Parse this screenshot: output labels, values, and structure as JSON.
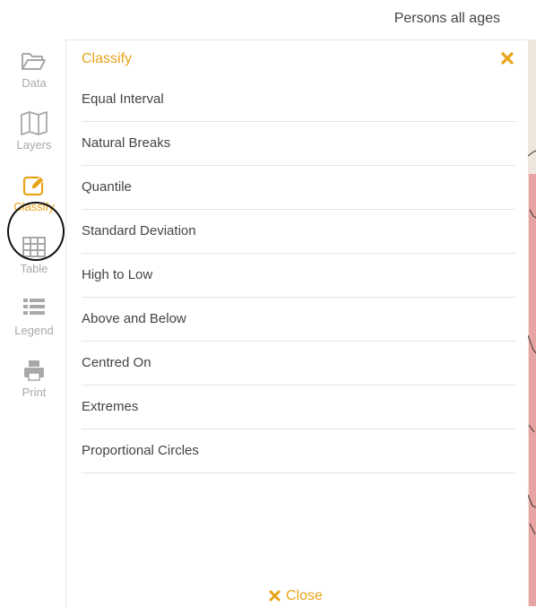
{
  "header": {
    "title": "Persons all ages"
  },
  "sidebar": {
    "items": [
      {
        "label": "Data",
        "icon": "folder-icon"
      },
      {
        "label": "Layers",
        "icon": "map-icon"
      },
      {
        "label": "Classify",
        "icon": "edit-icon",
        "active": true
      },
      {
        "label": "Table",
        "icon": "table-icon"
      },
      {
        "label": "Legend",
        "icon": "list-icon"
      },
      {
        "label": "Print",
        "icon": "printer-icon"
      }
    ]
  },
  "panel": {
    "title": "Classify",
    "options": [
      "Equal Interval",
      "Natural Breaks",
      "Quantile",
      "Standard Deviation",
      "High to Low",
      "Above and Below",
      "Centred On",
      "Extremes",
      "Proportional Circles"
    ],
    "close_label": "Close"
  },
  "colors": {
    "accent": "#e8a317",
    "inactive_icon": "#a8a8a8",
    "text": "#444444",
    "map_fill": "#e8a3a3"
  }
}
